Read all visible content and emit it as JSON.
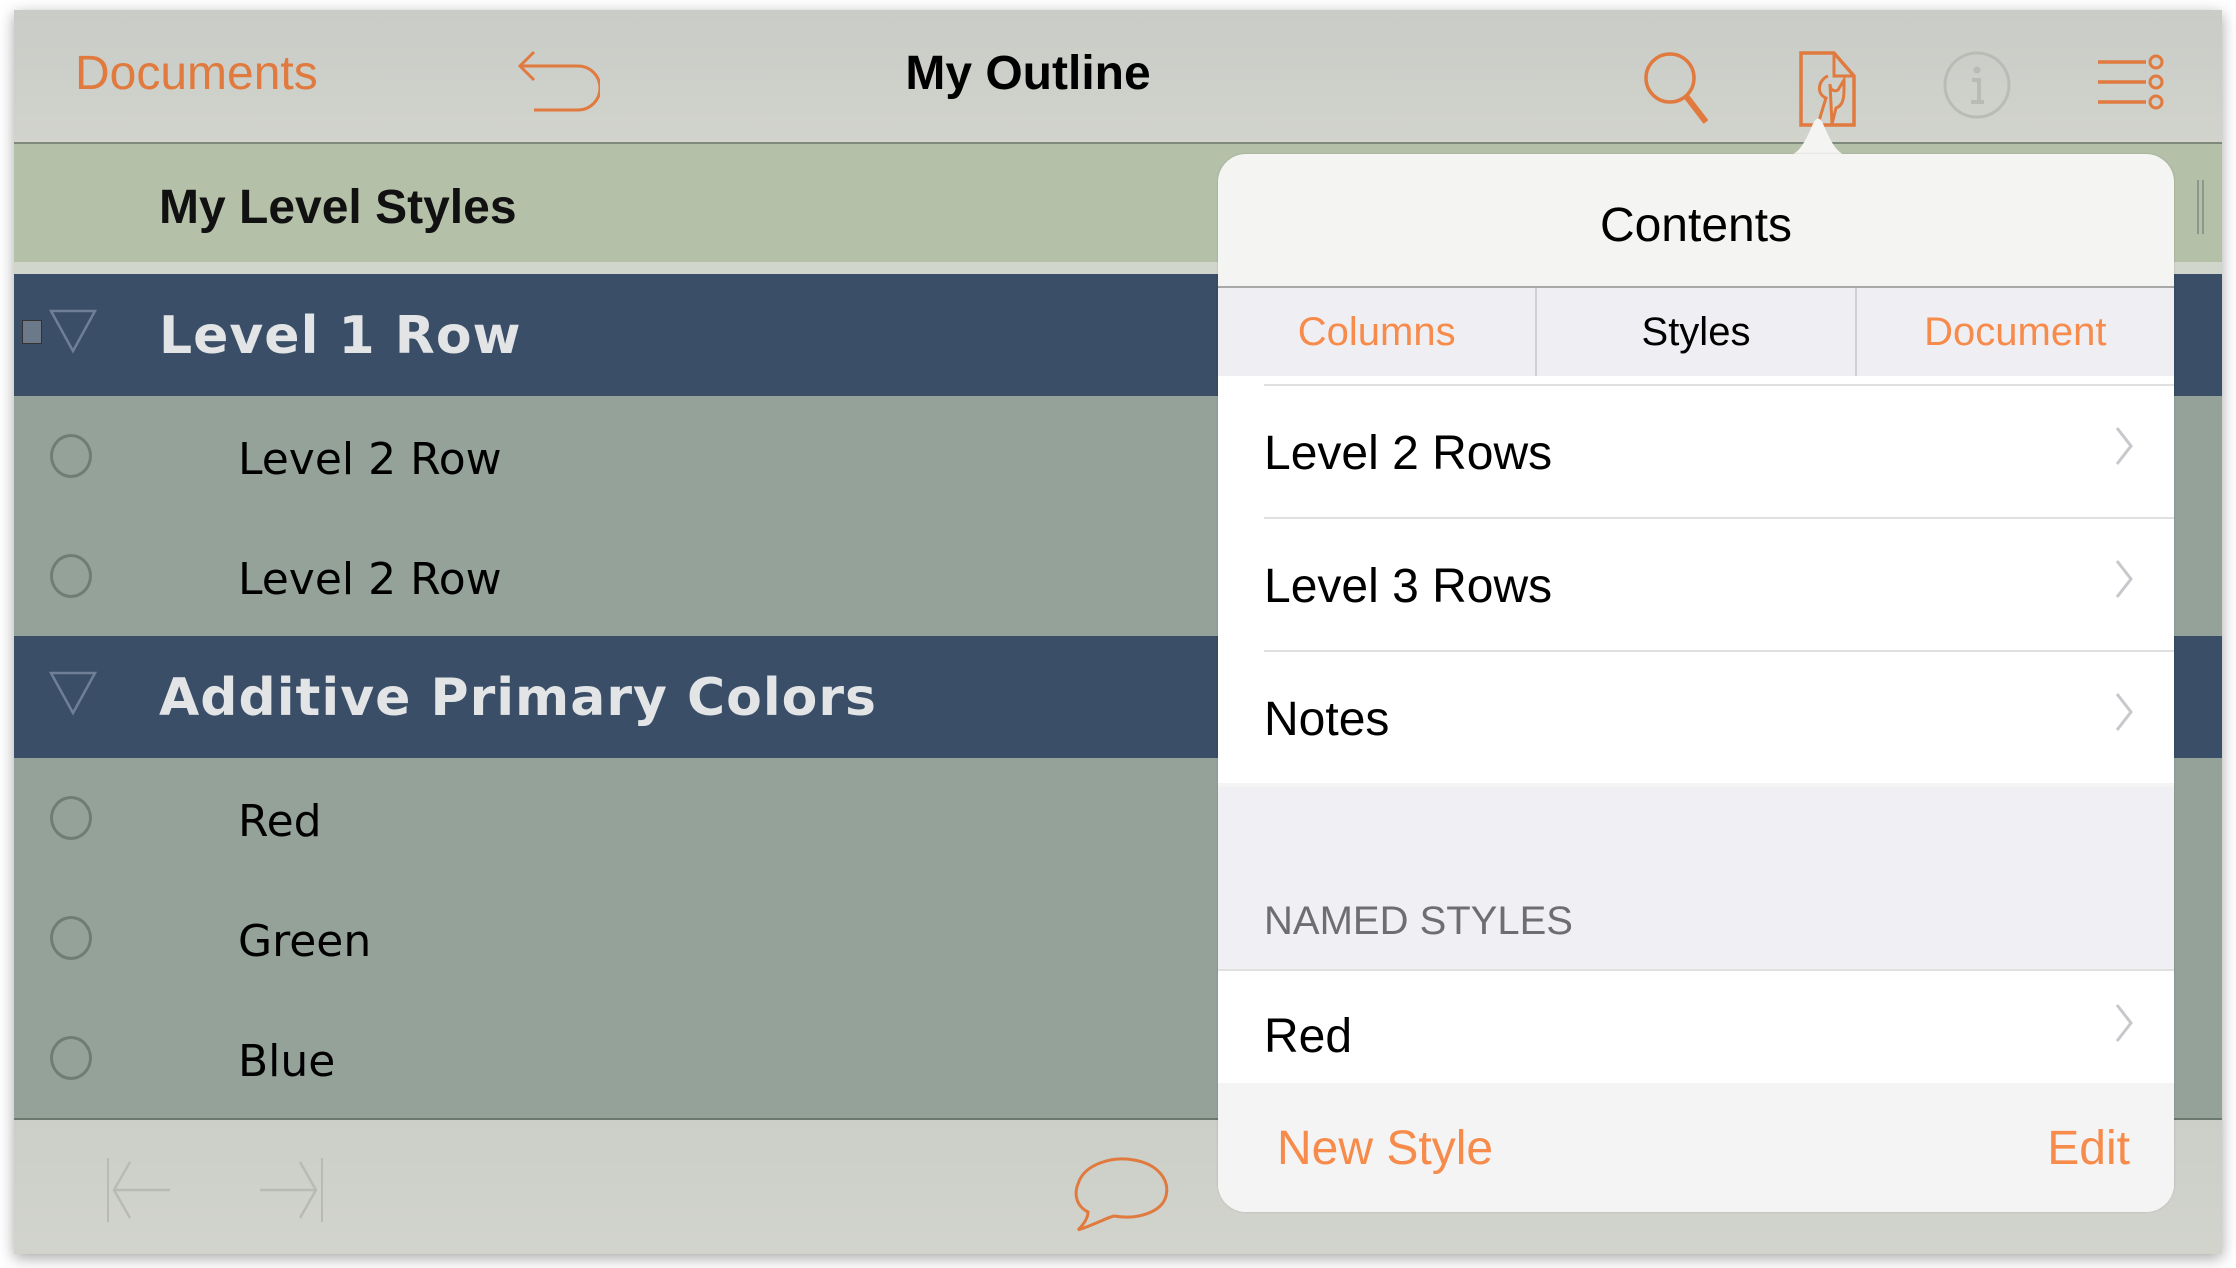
{
  "nav": {
    "back_label": "Documents",
    "title": "My Outline",
    "icons": [
      "undo-icon",
      "search-icon",
      "inspector-tools-icon",
      "info-icon",
      "outline-menu-icon"
    ]
  },
  "outline": {
    "section_header": "My Level Styles",
    "rows": [
      {
        "level": 1,
        "text": "Level 1 Row",
        "expanded": true,
        "has_note": true
      },
      {
        "level": 2,
        "text": "Level 2 Row"
      },
      {
        "level": 2,
        "text": "Level 2 Row"
      },
      {
        "level": 1,
        "text": "Additive Primary Colors",
        "expanded": true
      },
      {
        "level": 2,
        "text": "Red"
      },
      {
        "level": 2,
        "text": "Green"
      },
      {
        "level": 2,
        "text": "Blue"
      }
    ]
  },
  "bottom_bar": {
    "icons": [
      "outdent-icon",
      "indent-icon",
      "add-note-icon"
    ]
  },
  "popover": {
    "title": "Contents",
    "tabs": [
      {
        "label": "Columns",
        "active": false
      },
      {
        "label": "Styles",
        "active": true
      },
      {
        "label": "Document",
        "active": false
      }
    ],
    "style_items": [
      {
        "label": "Level 2 Rows"
      },
      {
        "label": "Level 3 Rows"
      },
      {
        "label": "Notes"
      }
    ],
    "named_styles_header": "NAMED STYLES",
    "named_styles": [
      {
        "label": "Red"
      }
    ],
    "footer": {
      "new_style_label": "New Style",
      "edit_label": "Edit"
    }
  },
  "colors": {
    "accent": "#e07a3e",
    "popover_accent": "#f68b4b",
    "level1_row_bg": "#3a4e68",
    "level2_row_bg": "#94a29a",
    "section_header_bg": "#b5c0a9"
  }
}
